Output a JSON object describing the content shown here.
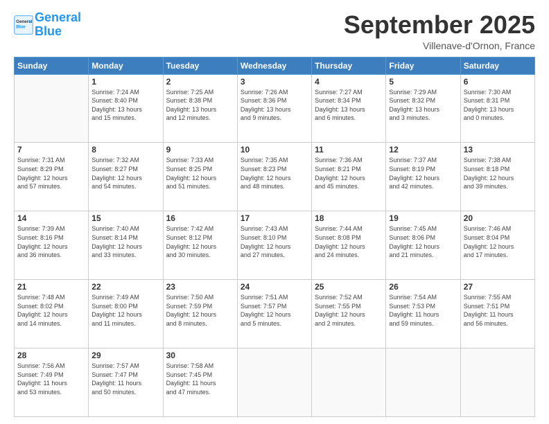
{
  "logo": {
    "line1": "General",
    "line2": "Blue"
  },
  "title": "September 2025",
  "location": "Villenave-d'Ornon, France",
  "days_of_week": [
    "Sunday",
    "Monday",
    "Tuesday",
    "Wednesday",
    "Thursday",
    "Friday",
    "Saturday"
  ],
  "weeks": [
    [
      {
        "day": "",
        "info": ""
      },
      {
        "day": "1",
        "info": "Sunrise: 7:24 AM\nSunset: 8:40 PM\nDaylight: 13 hours\nand 15 minutes."
      },
      {
        "day": "2",
        "info": "Sunrise: 7:25 AM\nSunset: 8:38 PM\nDaylight: 13 hours\nand 12 minutes."
      },
      {
        "day": "3",
        "info": "Sunrise: 7:26 AM\nSunset: 8:36 PM\nDaylight: 13 hours\nand 9 minutes."
      },
      {
        "day": "4",
        "info": "Sunrise: 7:27 AM\nSunset: 8:34 PM\nDaylight: 13 hours\nand 6 minutes."
      },
      {
        "day": "5",
        "info": "Sunrise: 7:29 AM\nSunset: 8:32 PM\nDaylight: 13 hours\nand 3 minutes."
      },
      {
        "day": "6",
        "info": "Sunrise: 7:30 AM\nSunset: 8:31 PM\nDaylight: 13 hours\nand 0 minutes."
      }
    ],
    [
      {
        "day": "7",
        "info": "Sunrise: 7:31 AM\nSunset: 8:29 PM\nDaylight: 12 hours\nand 57 minutes."
      },
      {
        "day": "8",
        "info": "Sunrise: 7:32 AM\nSunset: 8:27 PM\nDaylight: 12 hours\nand 54 minutes."
      },
      {
        "day": "9",
        "info": "Sunrise: 7:33 AM\nSunset: 8:25 PM\nDaylight: 12 hours\nand 51 minutes."
      },
      {
        "day": "10",
        "info": "Sunrise: 7:35 AM\nSunset: 8:23 PM\nDaylight: 12 hours\nand 48 minutes."
      },
      {
        "day": "11",
        "info": "Sunrise: 7:36 AM\nSunset: 8:21 PM\nDaylight: 12 hours\nand 45 minutes."
      },
      {
        "day": "12",
        "info": "Sunrise: 7:37 AM\nSunset: 8:19 PM\nDaylight: 12 hours\nand 42 minutes."
      },
      {
        "day": "13",
        "info": "Sunrise: 7:38 AM\nSunset: 8:18 PM\nDaylight: 12 hours\nand 39 minutes."
      }
    ],
    [
      {
        "day": "14",
        "info": "Sunrise: 7:39 AM\nSunset: 8:16 PM\nDaylight: 12 hours\nand 36 minutes."
      },
      {
        "day": "15",
        "info": "Sunrise: 7:40 AM\nSunset: 8:14 PM\nDaylight: 12 hours\nand 33 minutes."
      },
      {
        "day": "16",
        "info": "Sunrise: 7:42 AM\nSunset: 8:12 PM\nDaylight: 12 hours\nand 30 minutes."
      },
      {
        "day": "17",
        "info": "Sunrise: 7:43 AM\nSunset: 8:10 PM\nDaylight: 12 hours\nand 27 minutes."
      },
      {
        "day": "18",
        "info": "Sunrise: 7:44 AM\nSunset: 8:08 PM\nDaylight: 12 hours\nand 24 minutes."
      },
      {
        "day": "19",
        "info": "Sunrise: 7:45 AM\nSunset: 8:06 PM\nDaylight: 12 hours\nand 21 minutes."
      },
      {
        "day": "20",
        "info": "Sunrise: 7:46 AM\nSunset: 8:04 PM\nDaylight: 12 hours\nand 17 minutes."
      }
    ],
    [
      {
        "day": "21",
        "info": "Sunrise: 7:48 AM\nSunset: 8:02 PM\nDaylight: 12 hours\nand 14 minutes."
      },
      {
        "day": "22",
        "info": "Sunrise: 7:49 AM\nSunset: 8:00 PM\nDaylight: 12 hours\nand 11 minutes."
      },
      {
        "day": "23",
        "info": "Sunrise: 7:50 AM\nSunset: 7:59 PM\nDaylight: 12 hours\nand 8 minutes."
      },
      {
        "day": "24",
        "info": "Sunrise: 7:51 AM\nSunset: 7:57 PM\nDaylight: 12 hours\nand 5 minutes."
      },
      {
        "day": "25",
        "info": "Sunrise: 7:52 AM\nSunset: 7:55 PM\nDaylight: 12 hours\nand 2 minutes."
      },
      {
        "day": "26",
        "info": "Sunrise: 7:54 AM\nSunset: 7:53 PM\nDaylight: 11 hours\nand 59 minutes."
      },
      {
        "day": "27",
        "info": "Sunrise: 7:55 AM\nSunset: 7:51 PM\nDaylight: 11 hours\nand 56 minutes."
      }
    ],
    [
      {
        "day": "28",
        "info": "Sunrise: 7:56 AM\nSunset: 7:49 PM\nDaylight: 11 hours\nand 53 minutes."
      },
      {
        "day": "29",
        "info": "Sunrise: 7:57 AM\nSunset: 7:47 PM\nDaylight: 11 hours\nand 50 minutes."
      },
      {
        "day": "30",
        "info": "Sunrise: 7:58 AM\nSunset: 7:45 PM\nDaylight: 11 hours\nand 47 minutes."
      },
      {
        "day": "",
        "info": ""
      },
      {
        "day": "",
        "info": ""
      },
      {
        "day": "",
        "info": ""
      },
      {
        "day": "",
        "info": ""
      }
    ]
  ]
}
